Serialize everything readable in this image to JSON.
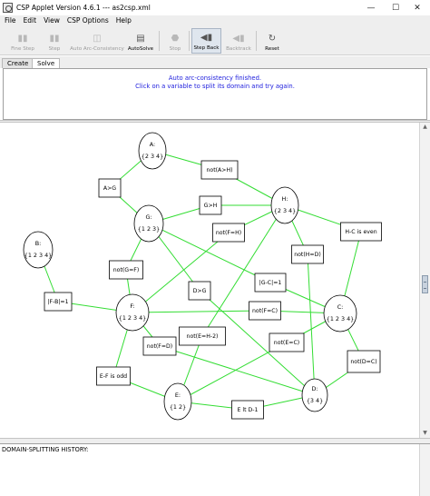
{
  "window": {
    "title": "CSP Applet Version 4.6.1 --- as2csp.xml"
  },
  "window_buttons": {
    "minimize": "—",
    "maximize": "☐",
    "close": "✕"
  },
  "menu": [
    "File",
    "Edit",
    "View",
    "CSP Options",
    "Help"
  ],
  "toolbar": {
    "fine_step": "Fine Step",
    "step": "Step",
    "auto_arc": "Auto Arc-Consistency",
    "auto_solve": "AutoSolve",
    "stop": "Stop",
    "step_back": "Step Back",
    "backtrack": "Backtrack",
    "reset": "Reset"
  },
  "tabs": {
    "create": "Create",
    "solve": "Solve",
    "active": "Solve"
  },
  "messages": {
    "line1": "Auto arc-consistency finished.",
    "line2": "Click on a variable to split its domain and try again."
  },
  "colors": {
    "message_text": "#2020dd",
    "edge": "#33dd33"
  },
  "graph": {
    "variables": [
      {
        "id": "A",
        "name": "A:",
        "domain": "{2 3 4}"
      },
      {
        "id": "B",
        "name": "B:",
        "domain": "{1 2 3 4}"
      },
      {
        "id": "G",
        "name": "G:",
        "domain": "{1 2 3}"
      },
      {
        "id": "H",
        "name": "H:",
        "domain": "{2 3 4}"
      },
      {
        "id": "F",
        "name": "F:",
        "domain": "{1 2 3 4}"
      },
      {
        "id": "C",
        "name": "C:",
        "domain": "{1 2 3 4}"
      },
      {
        "id": "E",
        "name": "E:",
        "domain": "{1 2}"
      },
      {
        "id": "D",
        "name": "D:",
        "domain": "{3 4}"
      }
    ],
    "constraints": [
      {
        "id": "c1",
        "label": "A>G"
      },
      {
        "id": "c2",
        "label": "not(A>H)"
      },
      {
        "id": "c3",
        "label": "G>H"
      },
      {
        "id": "c4",
        "label": "not(F=H)"
      },
      {
        "id": "c5",
        "label": "H-C is even"
      },
      {
        "id": "c6",
        "label": "not(H=D)"
      },
      {
        "id": "c7",
        "label": "not(G=F)"
      },
      {
        "id": "c8",
        "label": "D>G"
      },
      {
        "id": "c9",
        "label": "|G-C|=1"
      },
      {
        "id": "c10",
        "label": "|F-B|=1"
      },
      {
        "id": "c11",
        "label": "not(F=C)"
      },
      {
        "id": "c12",
        "label": "not(E=H-2)"
      },
      {
        "id": "c13",
        "label": "not(F=D)"
      },
      {
        "id": "c14",
        "label": "not(E=C)"
      },
      {
        "id": "c15",
        "label": "not(D=C)"
      },
      {
        "id": "c16",
        "label": "E-F is odd"
      },
      {
        "id": "c17",
        "label": "E lt D-1"
      }
    ]
  },
  "history": {
    "label": "DOMAIN-SPLITTING HISTORY:"
  }
}
